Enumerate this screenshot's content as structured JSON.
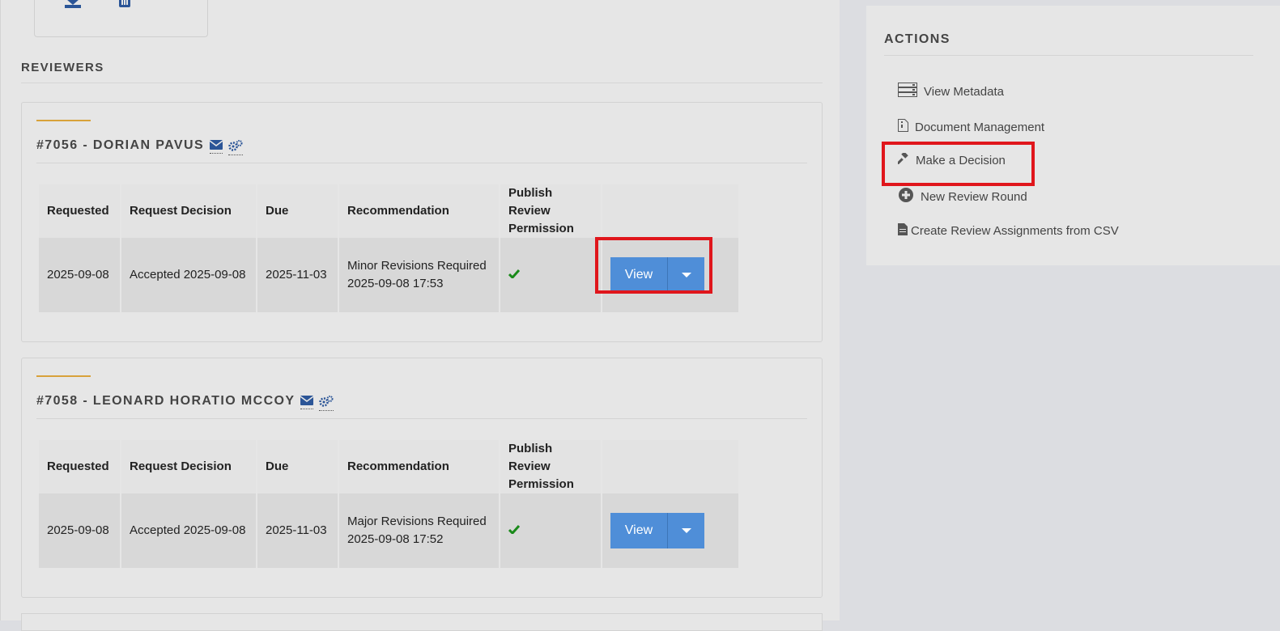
{
  "reviewers_section": {
    "title": "REVIEWERS"
  },
  "table_headers": {
    "requested": "Requested",
    "request_decision": "Request Decision",
    "due": "Due",
    "recommendation": "Recommendation",
    "publish_permission_line1": "Publish Review",
    "publish_permission_line2": "Permission"
  },
  "reviewers": [
    {
      "title": "#7056 - DORIAN PAVUS",
      "requested": "2025-09-08",
      "request_decision": "Accepted 2025-09-08",
      "due": "2025-11-03",
      "recommendation": "Minor Revisions Required",
      "recommendation_date": "2025-09-08 17:53",
      "permission_icon": "check-icon",
      "view_label": "View"
    },
    {
      "title": "#7058 - LEONARD HORATIO MCCOY",
      "requested": "2025-09-08",
      "request_decision": "Accepted 2025-09-08",
      "due": "2025-11-03",
      "recommendation": "Major Revisions Required",
      "recommendation_date": "2025-09-08 17:52",
      "permission_icon": "check-icon",
      "view_label": "View"
    }
  ],
  "actions": {
    "title": "ACTIONS",
    "items": [
      {
        "label": "View Metadata",
        "icon": "metadata-icon"
      },
      {
        "label": "Document Management",
        "icon": "document-icon"
      },
      {
        "label": "Make a Decision",
        "icon": "gavel-icon"
      },
      {
        "label": "New Review Round",
        "icon": "plus-circle-icon"
      },
      {
        "label": "Create Review Assignments from CSV",
        "icon": "file-icon"
      }
    ]
  },
  "colors": {
    "accent_line": "#d8a23a",
    "button_blue": "#4f8ed8",
    "icon_blue": "#2b5597",
    "check_green": "#1a8a1a",
    "highlight_red": "#e0161c"
  }
}
